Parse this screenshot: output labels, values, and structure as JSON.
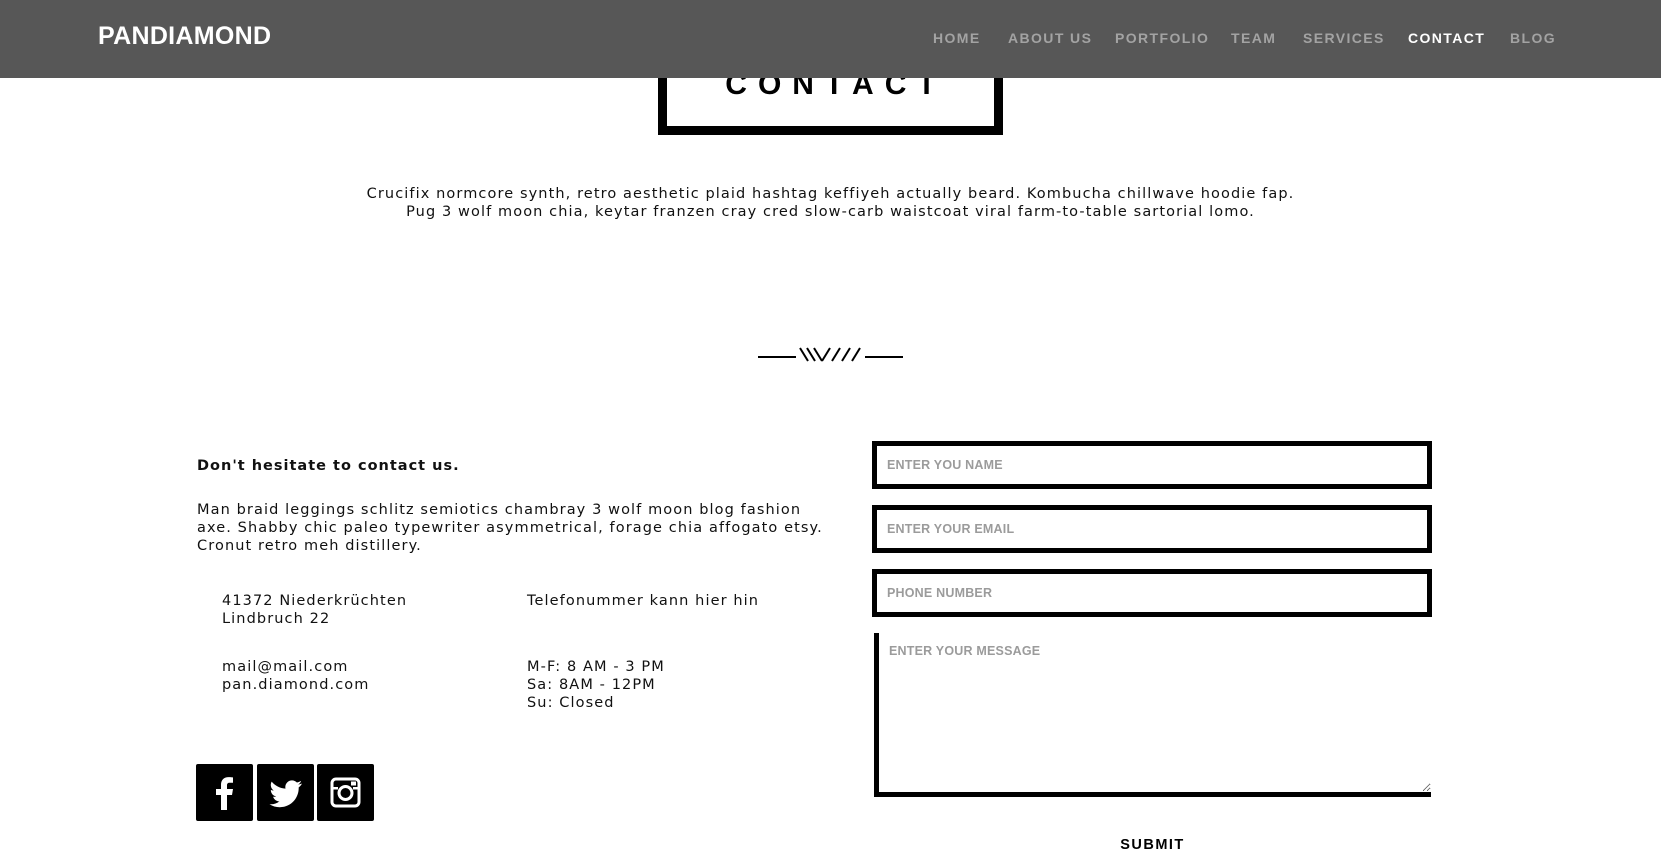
{
  "header": {
    "brand": "PANDIAMOND",
    "nav": [
      {
        "label": "HOME",
        "active": false
      },
      {
        "label": "ABOUT US",
        "active": false
      },
      {
        "label": "PORTFOLIO",
        "active": false
      },
      {
        "label": "TEAM",
        "active": false
      },
      {
        "label": "SERVICES",
        "active": false
      },
      {
        "label": "CONTACT",
        "active": true
      },
      {
        "label": "BLOG",
        "active": false
      }
    ]
  },
  "section": {
    "title": "CONTACT",
    "intro_line1": "Crucifix normcore synth, retro aesthetic plaid hashtag keffiyeh actually beard. Kombucha chillwave hoodie fap.",
    "intro_line2": "Pug 3 wolf moon chia, keytar franzen cray cred slow-carb waistcoat viral farm-to-table sartorial lomo."
  },
  "contact_info": {
    "lead": "Don't hesitate to contact us.",
    "description": "Man braid leggings schlitz semiotics chambray 3 wolf moon blog fashion axe. Shabby chic paleo typewriter asymmetrical, forage chia affogato etsy. Cronut retro meh distillery.",
    "address_line1": "41372 Niederkrüchten",
    "address_line2": "Lindbruch 22",
    "phone": "Telefonummer kann hier hin",
    "email": "mail@mail.com",
    "website": "pan.diamond.com",
    "hours_weekday": "M-F: 8 AM - 3 PM",
    "hours_saturday": "Sa: 8AM - 12PM",
    "hours_sunday": "Su: Closed"
  },
  "social": [
    {
      "icon": "facebook-icon"
    },
    {
      "icon": "twitter-icon"
    },
    {
      "icon": "instagram-icon"
    }
  ],
  "form": {
    "name_placeholder": "ENTER YOU NAME",
    "email_placeholder": "ENTER YOUR EMAIL",
    "phone_placeholder": "PHONE NUMBER",
    "message_placeholder": "ENTER YOUR MESSAGE",
    "submit_label": "SUBMIT"
  },
  "colors": {
    "navbar_bg": "#575757",
    "nav_inactive": "#a3a3a3",
    "nav_active": "#ffffff",
    "text": "#111111",
    "border": "#000000"
  }
}
